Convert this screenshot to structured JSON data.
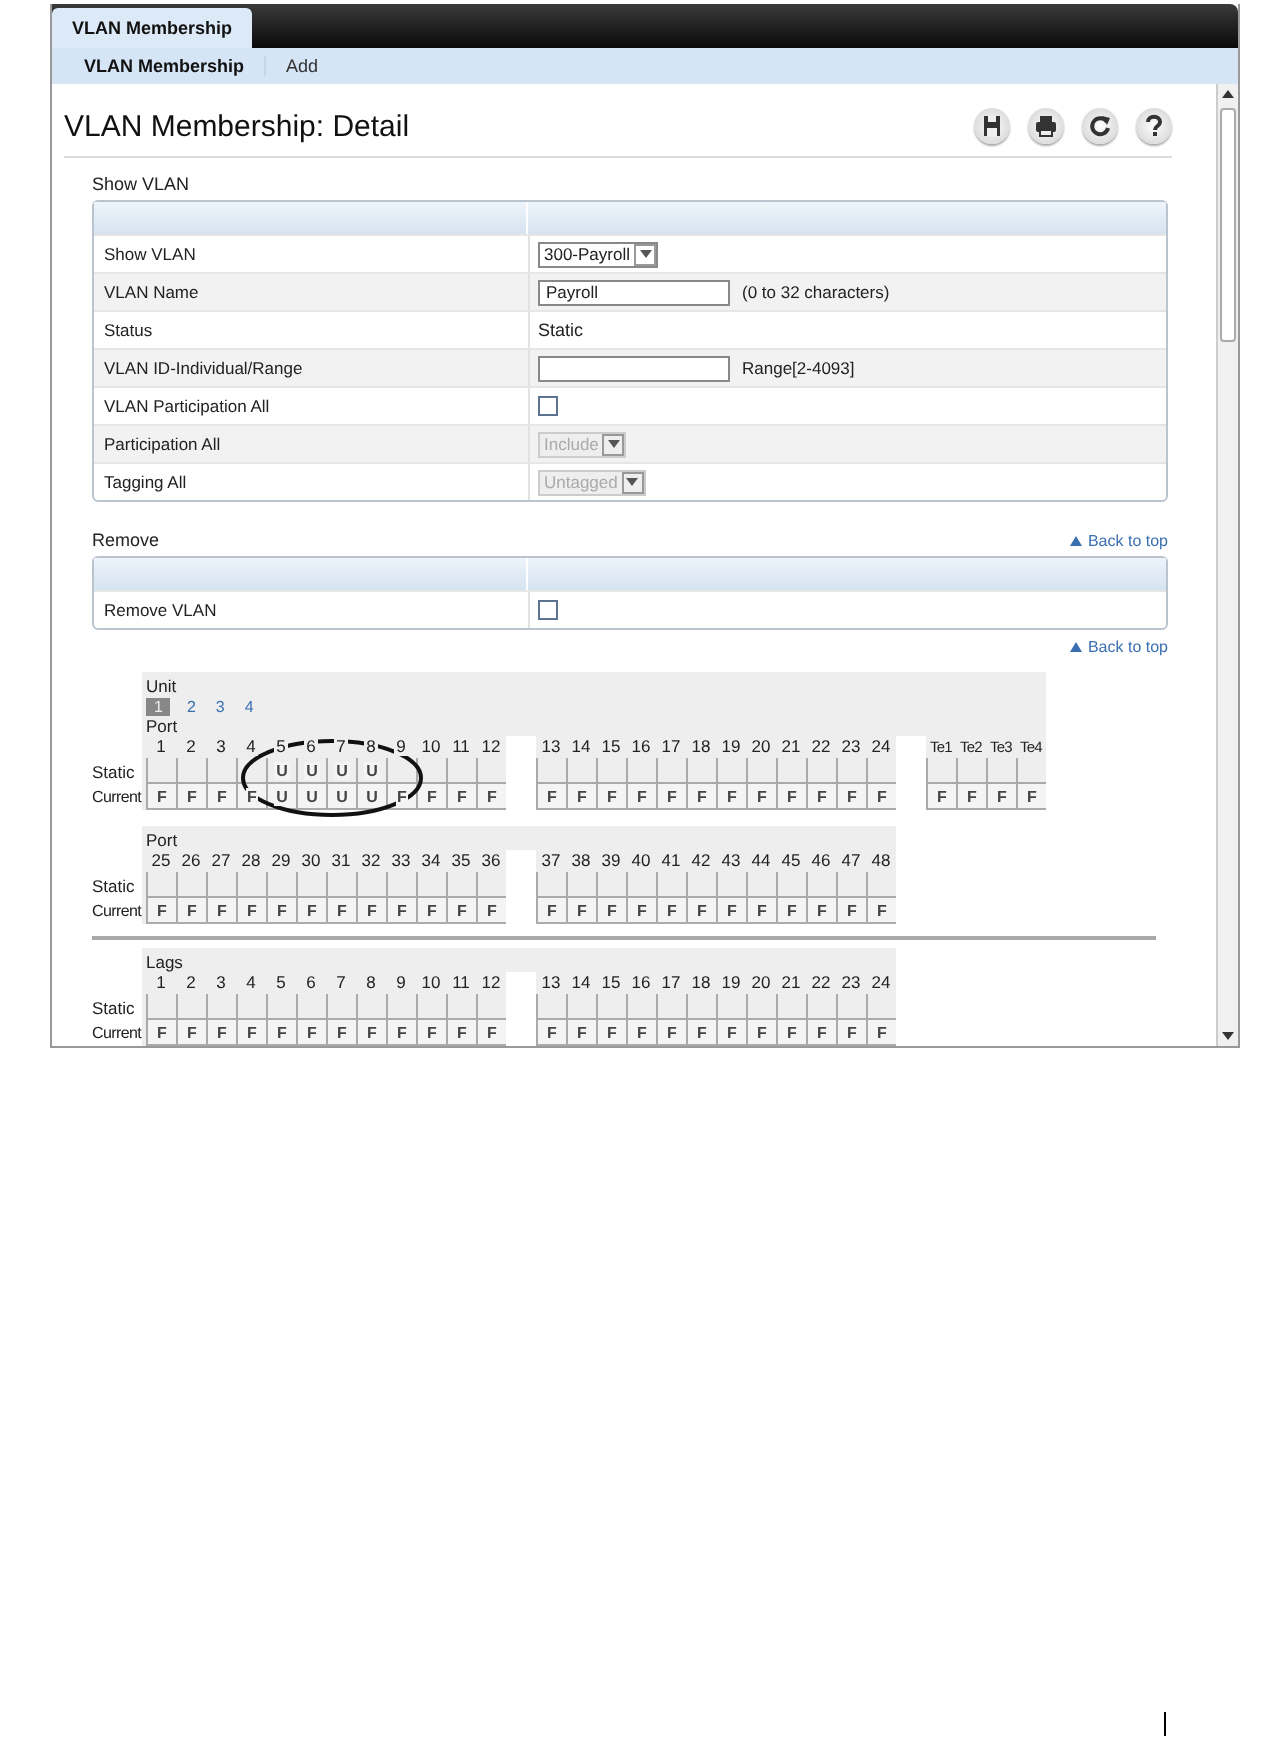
{
  "tabs": [
    {
      "label": "VLAN Membership",
      "selected": true
    }
  ],
  "subtabs": [
    {
      "label": "VLAN Membership",
      "selected": true
    },
    {
      "label": "Add",
      "selected": false
    }
  ],
  "page_title": "VLAN Membership: Detail",
  "show_vlan": {
    "heading": "Show VLAN",
    "rows": [
      {
        "kind": "select",
        "label": "Show VLAN",
        "value": "300-Payroll",
        "disabled": false
      },
      {
        "kind": "input",
        "label": "VLAN Name",
        "value": "Payroll",
        "hint": "(0 to 32 characters)"
      },
      {
        "kind": "text",
        "label": "Status",
        "value": "Static"
      },
      {
        "kind": "input",
        "label": "VLAN ID-Individual/Range",
        "hint": "Range[2-4093]"
      },
      {
        "kind": "checkbox",
        "label": "VLAN Participation All",
        "checked": false
      },
      {
        "kind": "select",
        "label": "Participation All",
        "value": "Include",
        "disabled": true
      },
      {
        "kind": "select",
        "label": "Tagging All",
        "value": "Untagged",
        "disabled": true
      }
    ]
  },
  "remove": {
    "heading": "Remove",
    "back_link": "Back to top",
    "rows": [
      {
        "kind": "checkbox",
        "label": "Remove VLAN",
        "checked": false
      }
    ]
  },
  "back_link": "Back to top",
  "unit_selector": {
    "label": "Unit",
    "units": [
      {
        "label": "1",
        "selected": true
      },
      {
        "label": "2",
        "selected": false
      },
      {
        "label": "3",
        "selected": false
      },
      {
        "label": "4",
        "selected": false
      }
    ]
  },
  "port_sections": [
    {
      "heading": "Port",
      "static_label": "Static",
      "current_label": "Current",
      "groups": [
        [
          {
            "port": "1",
            "current": "F"
          },
          {
            "port": "2",
            "current": "F"
          },
          {
            "port": "3",
            "current": "F"
          },
          {
            "port": "4",
            "current": "F"
          },
          {
            "port": "5",
            "static": "U",
            "current": "U"
          },
          {
            "port": "6",
            "static": "U",
            "current": "U"
          },
          {
            "port": "7",
            "static": "U",
            "current": "U"
          },
          {
            "port": "8",
            "static": "U",
            "current": "U"
          },
          {
            "port": "9",
            "current": "F"
          },
          {
            "port": "10",
            "current": "F"
          },
          {
            "port": "11",
            "current": "F"
          },
          {
            "port": "12",
            "current": "F"
          }
        ],
        [
          {
            "port": "13",
            "current": "F"
          },
          {
            "port": "14",
            "current": "F"
          },
          {
            "port": "15",
            "current": "F"
          },
          {
            "port": "16",
            "current": "F"
          },
          {
            "port": "17",
            "current": "F"
          },
          {
            "port": "18",
            "current": "F"
          },
          {
            "port": "19",
            "current": "F"
          },
          {
            "port": "20",
            "current": "F"
          },
          {
            "port": "21",
            "current": "F"
          },
          {
            "port": "22",
            "current": "F"
          },
          {
            "port": "23",
            "current": "F"
          },
          {
            "port": "24",
            "current": "F"
          }
        ],
        [
          {
            "port": "Te1",
            "current": "F"
          },
          {
            "port": "Te2",
            "current": "F"
          },
          {
            "port": "Te3",
            "current": "F"
          },
          {
            "port": "Te4",
            "current": "F"
          }
        ]
      ]
    },
    {
      "heading": "Port",
      "static_label": "Static",
      "current_label": "Current",
      "groups": [
        [
          {
            "port": "25",
            "current": "F"
          },
          {
            "port": "26",
            "current": "F"
          },
          {
            "port": "27",
            "current": "F"
          },
          {
            "port": "28",
            "current": "F"
          },
          {
            "port": "29",
            "current": "F"
          },
          {
            "port": "30",
            "current": "F"
          },
          {
            "port": "31",
            "current": "F"
          },
          {
            "port": "32",
            "current": "F"
          },
          {
            "port": "33",
            "current": "F"
          },
          {
            "port": "34",
            "current": "F"
          },
          {
            "port": "35",
            "current": "F"
          },
          {
            "port": "36",
            "current": "F"
          }
        ],
        [
          {
            "port": "37",
            "current": "F"
          },
          {
            "port": "38",
            "current": "F"
          },
          {
            "port": "39",
            "current": "F"
          },
          {
            "port": "40",
            "current": "F"
          },
          {
            "port": "41",
            "current": "F"
          },
          {
            "port": "42",
            "current": "F"
          },
          {
            "port": "43",
            "current": "F"
          },
          {
            "port": "44",
            "current": "F"
          },
          {
            "port": "45",
            "current": "F"
          },
          {
            "port": "46",
            "current": "F"
          },
          {
            "port": "47",
            "current": "F"
          },
          {
            "port": "48",
            "current": "F"
          }
        ]
      ]
    },
    {
      "heading": "Lags",
      "static_label": "Static",
      "current_label": "Current",
      "groups": [
        [
          {
            "port": "1",
            "current": "F"
          },
          {
            "port": "2",
            "current": "F"
          },
          {
            "port": "3",
            "current": "F"
          },
          {
            "port": "4",
            "current": "F"
          },
          {
            "port": "5",
            "current": "F"
          },
          {
            "port": "6",
            "current": "F"
          },
          {
            "port": "7",
            "current": "F"
          },
          {
            "port": "8",
            "current": "F"
          },
          {
            "port": "9",
            "current": "F"
          },
          {
            "port": "10",
            "current": "F"
          },
          {
            "port": "11",
            "current": "F"
          },
          {
            "port": "12",
            "current": "F"
          }
        ],
        [
          {
            "port": "13",
            "current": "F"
          },
          {
            "port": "14",
            "current": "F"
          },
          {
            "port": "15",
            "current": "F"
          },
          {
            "port": "16",
            "current": "F"
          },
          {
            "port": "17",
            "current": "F"
          },
          {
            "port": "18",
            "current": "F"
          },
          {
            "port": "19",
            "current": "F"
          },
          {
            "port": "20",
            "current": "F"
          },
          {
            "port": "21",
            "current": "F"
          },
          {
            "port": "22",
            "current": "F"
          },
          {
            "port": "23",
            "current": "F"
          },
          {
            "port": "24",
            "current": "F"
          }
        ]
      ]
    }
  ]
}
